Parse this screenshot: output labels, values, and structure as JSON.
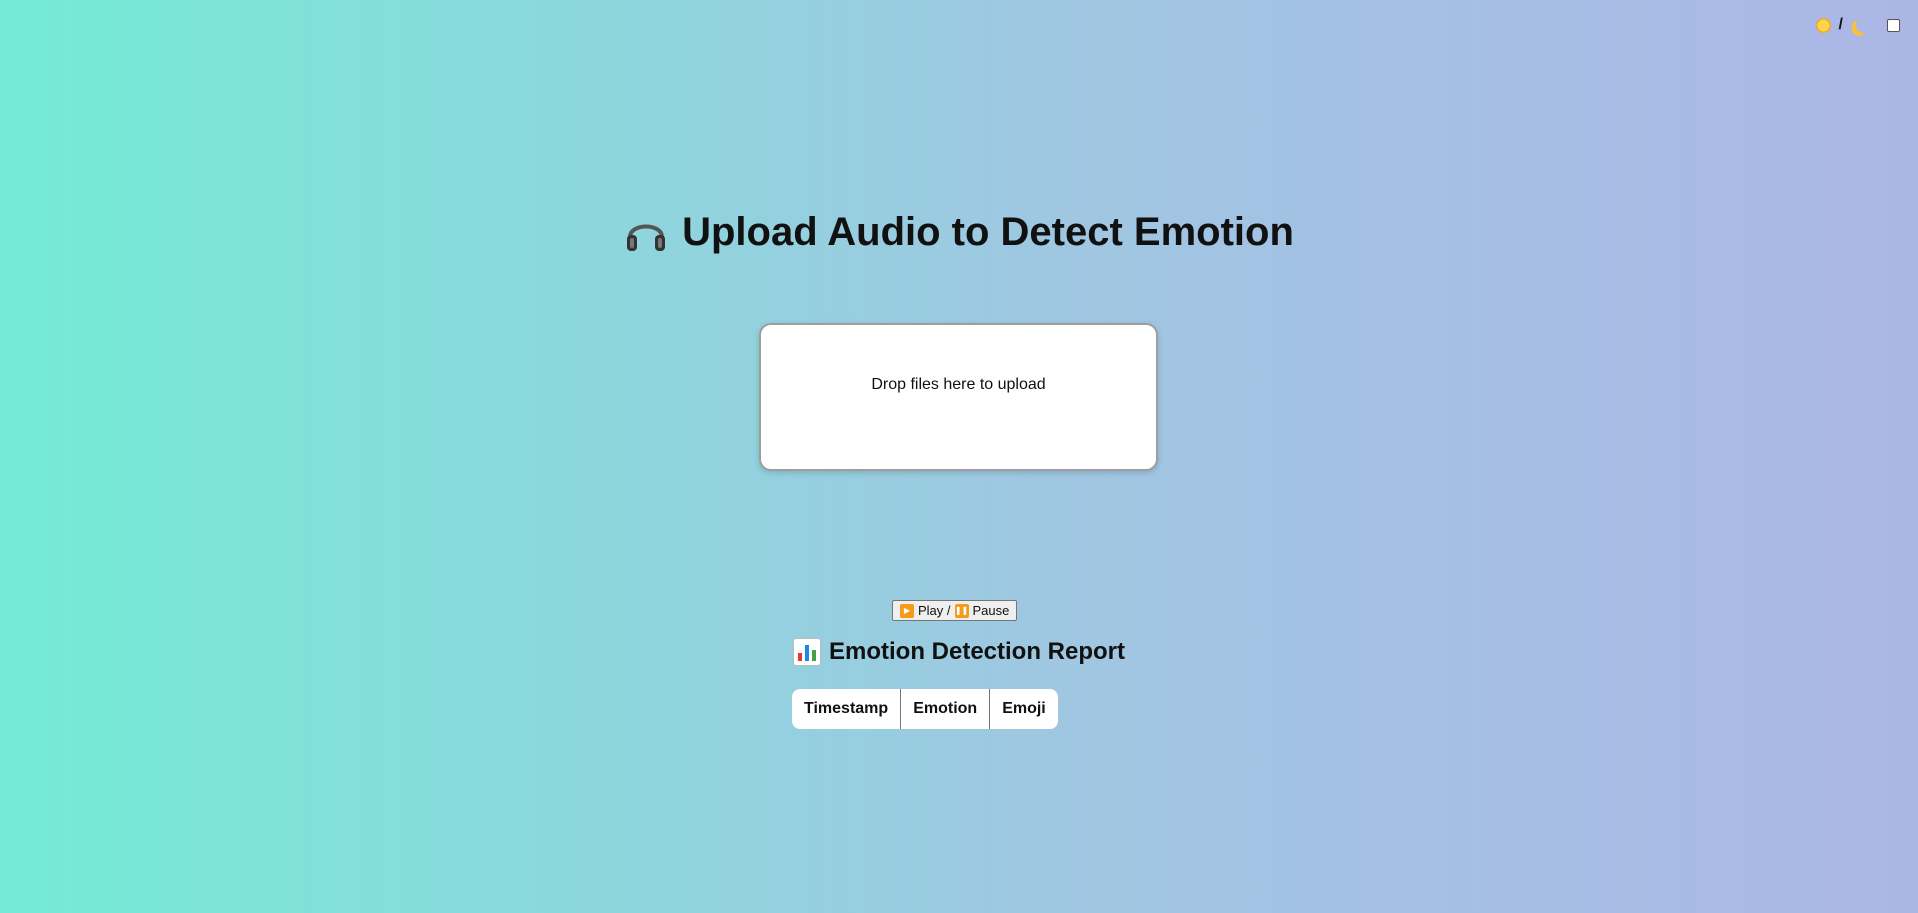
{
  "theme_toggle": {
    "separator": "/",
    "sun_icon": "sun-icon",
    "moon_icon": "moon-icon",
    "checked": false
  },
  "title": {
    "icon": "headphones-icon",
    "text": "Upload Audio to Detect Emotion"
  },
  "upload": {
    "prompt": "Drop files here to upload"
  },
  "player": {
    "play_label": "Play /",
    "pause_label": "Pause",
    "play_icon": "play-icon",
    "pause_icon": "pause-icon",
    "accent": "#f59b1a"
  },
  "report": {
    "icon": "bar-chart-icon",
    "title": "Emotion Detection Report",
    "columns": [
      "Timestamp",
      "Emotion",
      "Emoji"
    ]
  },
  "colors": {
    "gradient_start": "#74ebd5",
    "gradient_end": "#acb6e5"
  }
}
